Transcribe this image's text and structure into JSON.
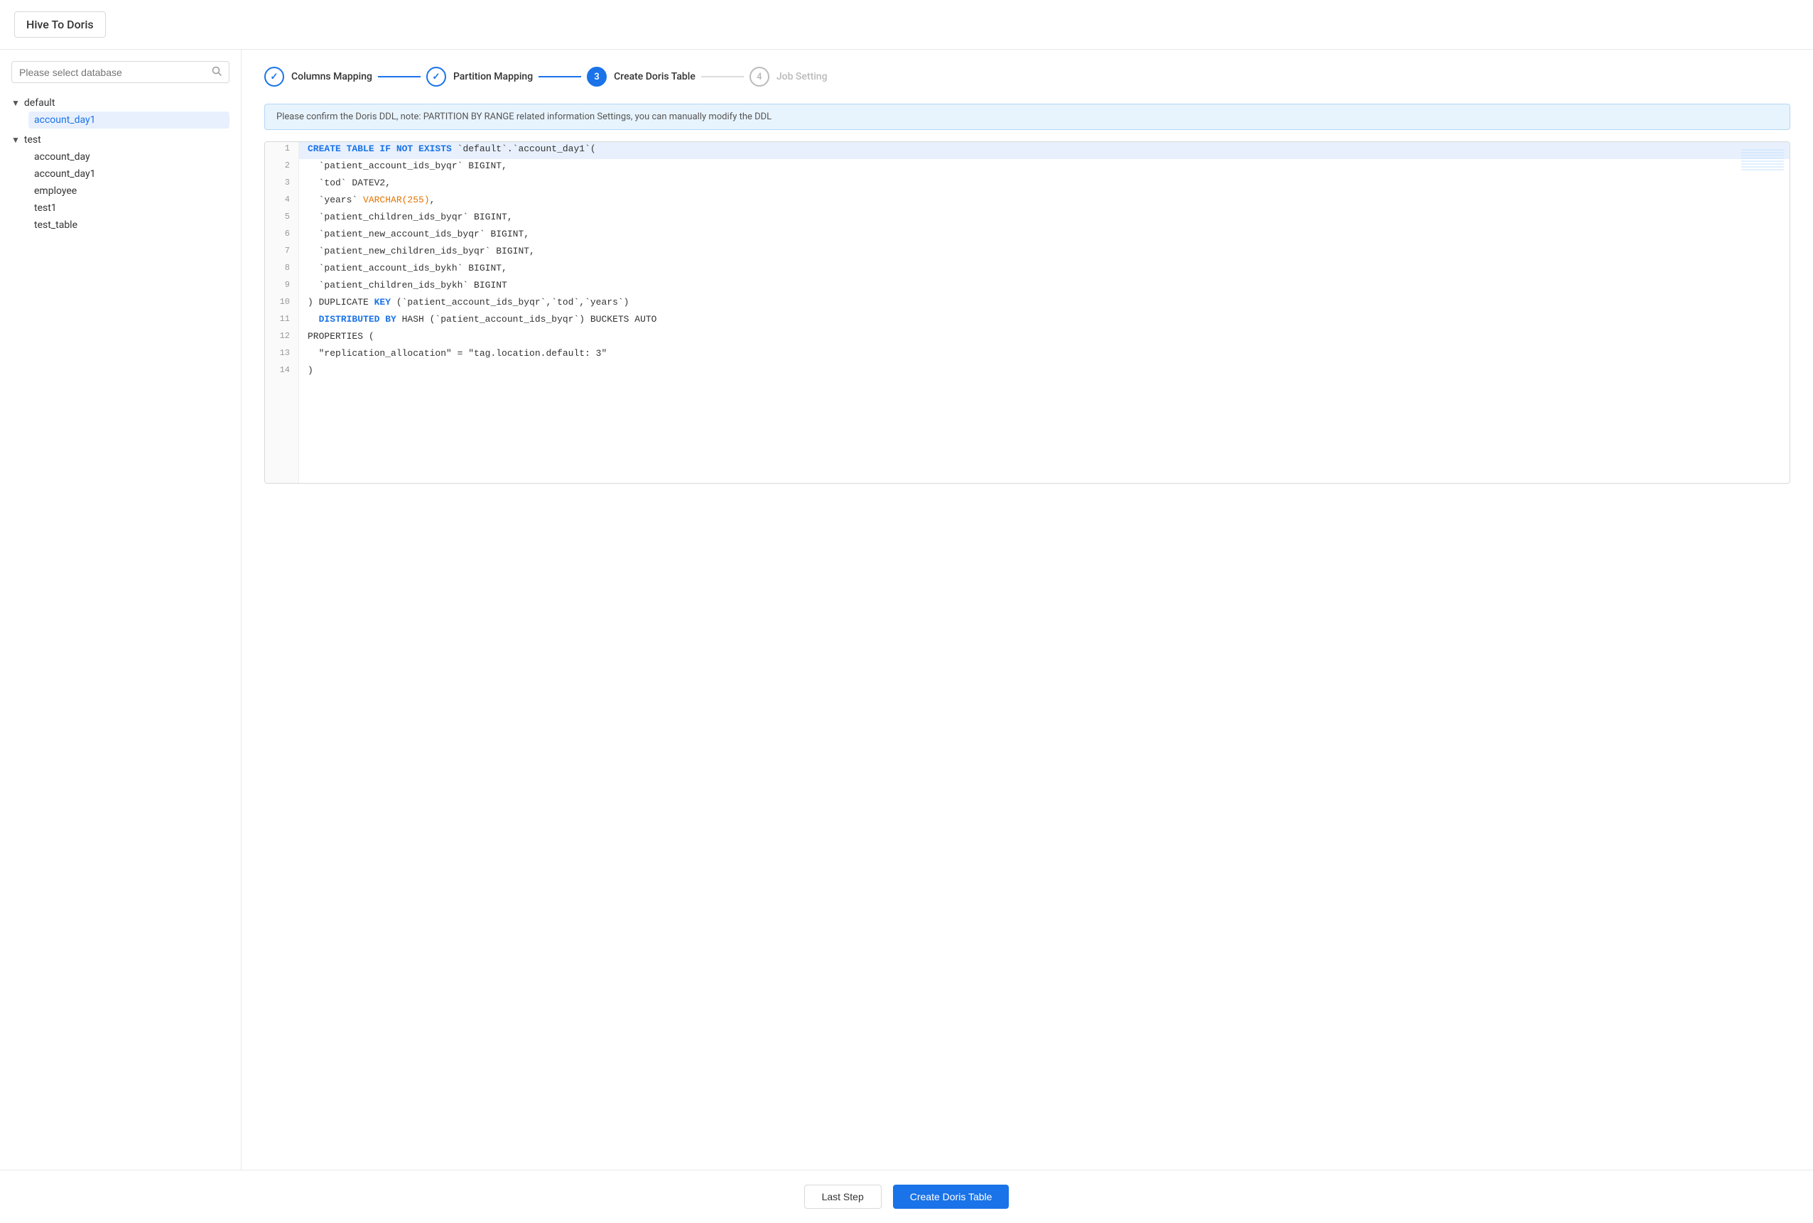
{
  "header": {
    "title": "Hive To Doris"
  },
  "sidebar": {
    "search_placeholder": "Please select database",
    "tree": [
      {
        "name": "default",
        "expanded": true,
        "children": [
          "account_day1"
        ]
      },
      {
        "name": "test",
        "expanded": true,
        "children": [
          "account_day",
          "account_day1",
          "employee",
          "test1",
          "test_table"
        ]
      }
    ],
    "selected_item": "account_day1"
  },
  "steps": [
    {
      "id": 1,
      "label": "Columns Mapping",
      "state": "completed",
      "icon": "✓"
    },
    {
      "id": 2,
      "label": "Partition Mapping",
      "state": "completed",
      "icon": "✓"
    },
    {
      "id": 3,
      "label": "Create Doris Table",
      "state": "active",
      "icon": "3"
    },
    {
      "id": 4,
      "label": "Job Setting",
      "state": "inactive",
      "icon": "4"
    }
  ],
  "info_message": "Please confirm the Doris DDL, note: PARTITION BY RANGE related information Settings, you can manually modify the DDL",
  "code": {
    "lines": [
      {
        "num": 1,
        "content": "CREATE TABLE IF NOT EXISTS `default`.`account_day1`("
      },
      {
        "num": 2,
        "content": "  `patient_account_ids_byqr` BIGINT,"
      },
      {
        "num": 3,
        "content": "  `tod` DATEV2,"
      },
      {
        "num": 4,
        "content": "  `years` VARCHAR(255),"
      },
      {
        "num": 5,
        "content": "  `patient_children_ids_byqr` BIGINT,"
      },
      {
        "num": 6,
        "content": "  `patient_new_account_ids_byqr` BIGINT,"
      },
      {
        "num": 7,
        "content": "  `patient_new_children_ids_byqr` BIGINT,"
      },
      {
        "num": 8,
        "content": "  `patient_account_ids_bykh` BIGINT,"
      },
      {
        "num": 9,
        "content": "  `patient_children_ids_bykh` BIGINT"
      },
      {
        "num": 10,
        "content": ") DUPLICATE KEY (`patient_account_ids_byqr`,`tod`,`years`)"
      },
      {
        "num": 11,
        "content": "  DISTRIBUTED BY HASH (`patient_account_ids_byqr`) BUCKETS AUTO"
      },
      {
        "num": 12,
        "content": "PROPERTIES ("
      },
      {
        "num": 13,
        "content": "  \"replication_allocation\" = \"tag.location.default: 3\""
      },
      {
        "num": 14,
        "content": ")"
      }
    ]
  },
  "buttons": {
    "last_step": "Last Step",
    "create_table": "Create Doris Table"
  }
}
